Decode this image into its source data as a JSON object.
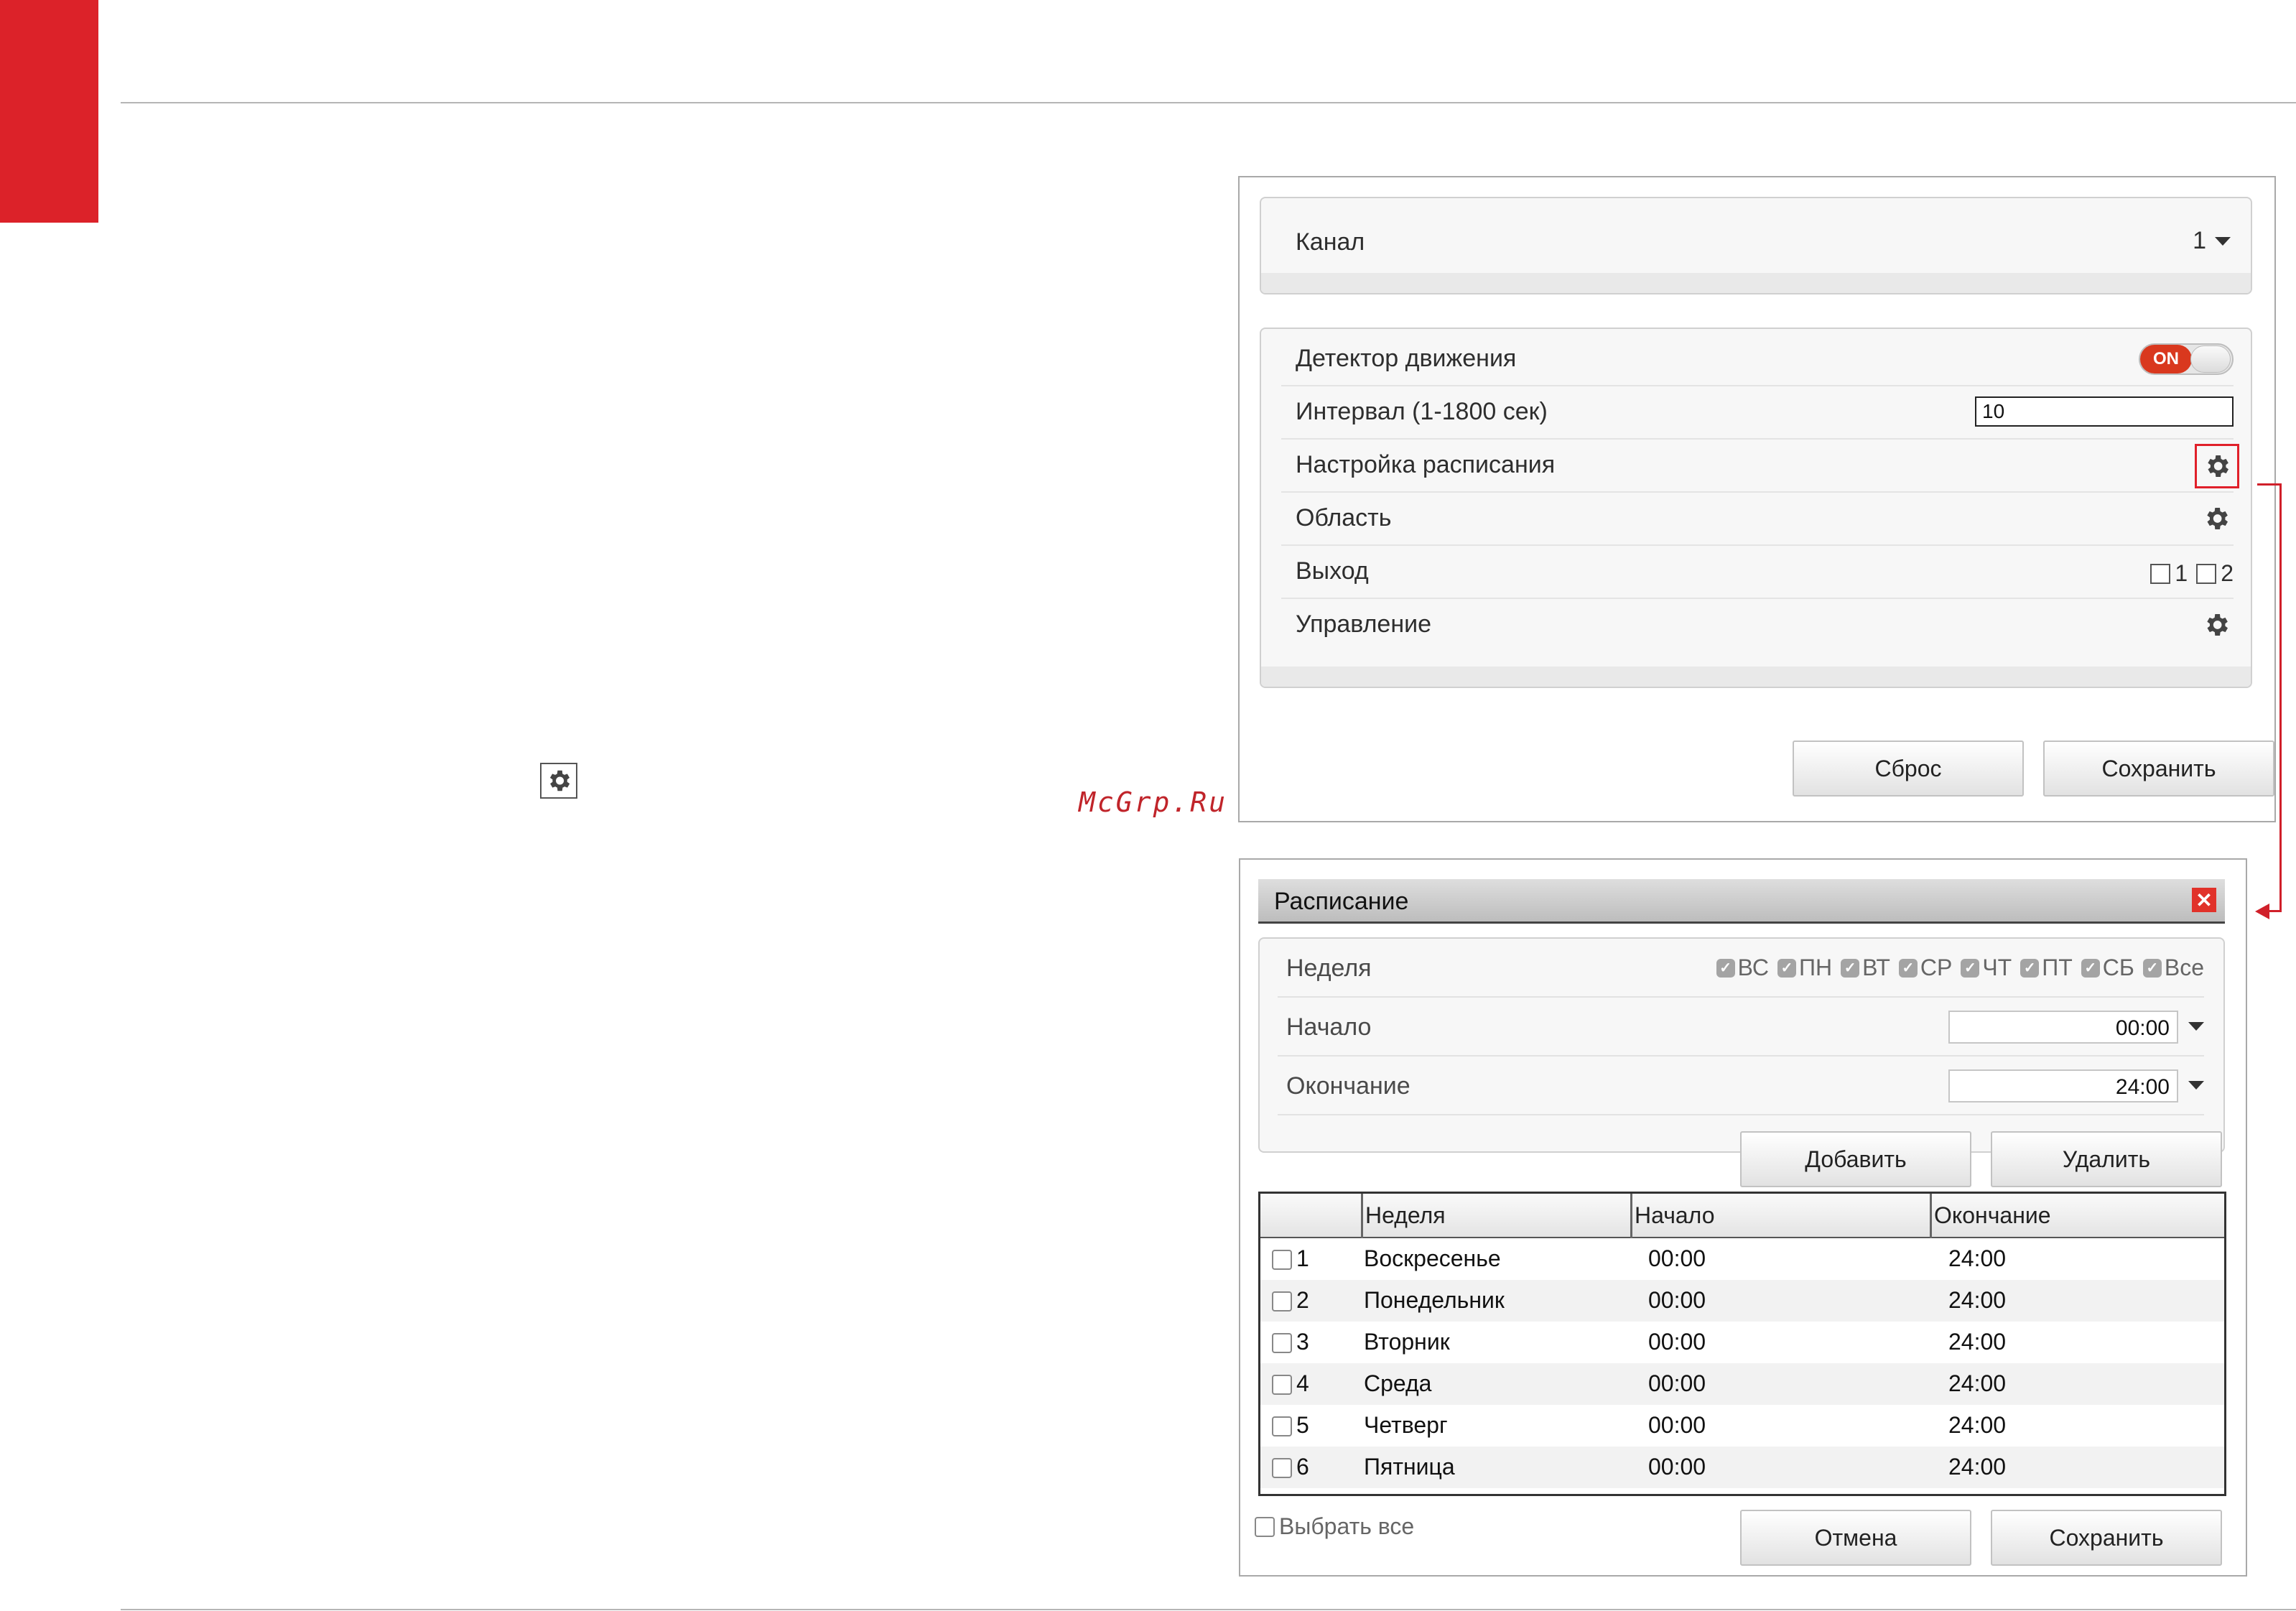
{
  "watermark": "McGrp.Ru",
  "panel_a": {
    "channel": {
      "label": "Канал",
      "value": "1"
    },
    "rows": {
      "motion": {
        "label": "Детектор движения",
        "toggle": "ON"
      },
      "interval": {
        "label": "Интервал (1-1800 сек)",
        "value": "10"
      },
      "schedule": {
        "label": "Настройка расписания"
      },
      "area": {
        "label": "Область"
      },
      "output": {
        "label": "Выход",
        "opt1": "1",
        "opt2": "2"
      },
      "control": {
        "label": "Управление"
      }
    },
    "buttons": {
      "reset": "Сброс",
      "save": "Сохранить"
    },
    "icons": {
      "settings": "gear-icon",
      "dropdown": "caret-down-icon"
    }
  },
  "schedule_dialog": {
    "title": "Расписание",
    "close_icon": "✕",
    "week_label": "Неделя",
    "days": [
      "ВС",
      "ПН",
      "ВТ",
      "СР",
      "ЧТ",
      "ПТ",
      "СБ",
      "Все"
    ],
    "days_checked": [
      true,
      true,
      true,
      true,
      true,
      true,
      true,
      true
    ],
    "start": {
      "label": "Начало",
      "value": "00:00"
    },
    "end": {
      "label": "Окончание",
      "value": "24:00"
    },
    "buttons": {
      "add": "Добавить",
      "delete": "Удалить",
      "cancel": "Отмена",
      "save": "Сохранить"
    },
    "table": {
      "headers": [
        "Неделя",
        "Начало",
        "Окончание"
      ],
      "rows": [
        {
          "num": "1",
          "day": "Воскресенье",
          "start": "00:00",
          "end": "24:00"
        },
        {
          "num": "2",
          "day": "Понедельник",
          "start": "00:00",
          "end": "24:00"
        },
        {
          "num": "3",
          "day": "Вторник",
          "start": "00:00",
          "end": "24:00"
        },
        {
          "num": "4",
          "day": "Среда",
          "start": "00:00",
          "end": "24:00"
        },
        {
          "num": "5",
          "day": "Четверг",
          "start": "00:00",
          "end": "24:00"
        },
        {
          "num": "6",
          "day": "Пятница",
          "start": "00:00",
          "end": "24:00"
        }
      ]
    },
    "select_all": "Выбрать все"
  },
  "colors": {
    "accent_red": "#dc2229",
    "toggle_on": "#d9381e",
    "close_red": "#e1322a"
  }
}
